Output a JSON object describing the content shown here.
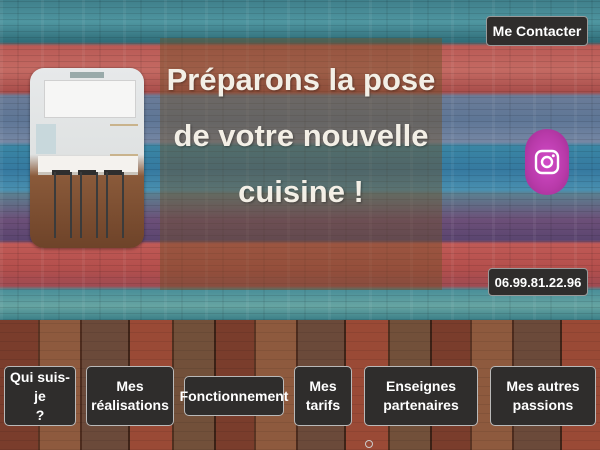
{
  "header": {
    "headline": "Préparons la pose de votre nouvelle cuisine !",
    "headline_lines": [
      "Préparons la pose",
      "de votre nouvelle",
      "cuisine !"
    ],
    "contact_label": "Me Contacter",
    "phone": "06.99.81.22.96",
    "social_icon": "instagram-icon"
  },
  "nav": {
    "items": [
      {
        "label_line1": "Qui suis-je",
        "label_line2": "?"
      },
      {
        "label_line1": "Mes",
        "label_line2": "réalisations"
      },
      {
        "label_line1": "Fonctionnement",
        "label_line2": ""
      },
      {
        "label_line1": "Mes",
        "label_line2": "tarifs"
      },
      {
        "label_line1": "Enseignes",
        "label_line2": "partenaires"
      },
      {
        "label_line1": "Mes autres",
        "label_line2": "passions"
      }
    ]
  },
  "colors": {
    "button_bg": "#2f2d2c",
    "instagram_accent": "#c043b8",
    "headline_text": "#f3efe6"
  }
}
